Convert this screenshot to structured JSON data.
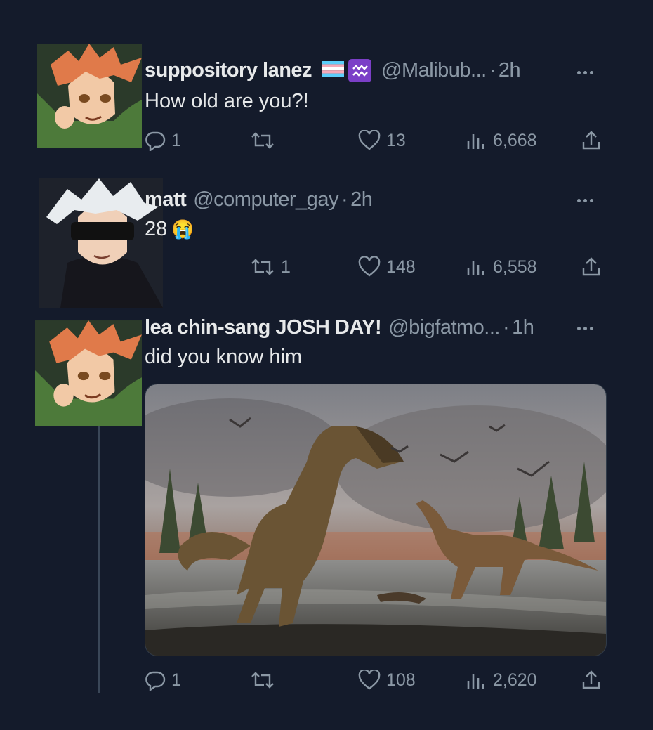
{
  "tweets": [
    {
      "name": "suppository lanez",
      "handle": "@Malibub...",
      "sep": "·",
      "time": "2h",
      "text": "How old are you?!",
      "replies": "1",
      "retweets": "",
      "likes": "13",
      "views": "6,668"
    },
    {
      "name": "matt",
      "handle": "@computer_gay",
      "sep": "·",
      "time": "2h",
      "text": "28",
      "emoji": "😭",
      "replies": "",
      "retweets": "1",
      "likes": "148",
      "views": "6,558"
    },
    {
      "name": "lea chin-sang JOSH DAY!",
      "handle": "@bigfatmo...",
      "sep": "·",
      "time": "1h",
      "text": "did you know him",
      "replies": "1",
      "retweets": "",
      "likes": "108",
      "views": "2,620"
    }
  ],
  "colors": {
    "background": "#141b2b",
    "text": "#e7e9ea",
    "muted": "#8b98a5",
    "aquarius_badge": "#7b3fc7"
  },
  "icons": [
    "reply-icon",
    "retweet-icon",
    "like-icon",
    "views-icon",
    "share-icon",
    "more-icon",
    "trans-flag-icon",
    "aquarius-icon"
  ]
}
